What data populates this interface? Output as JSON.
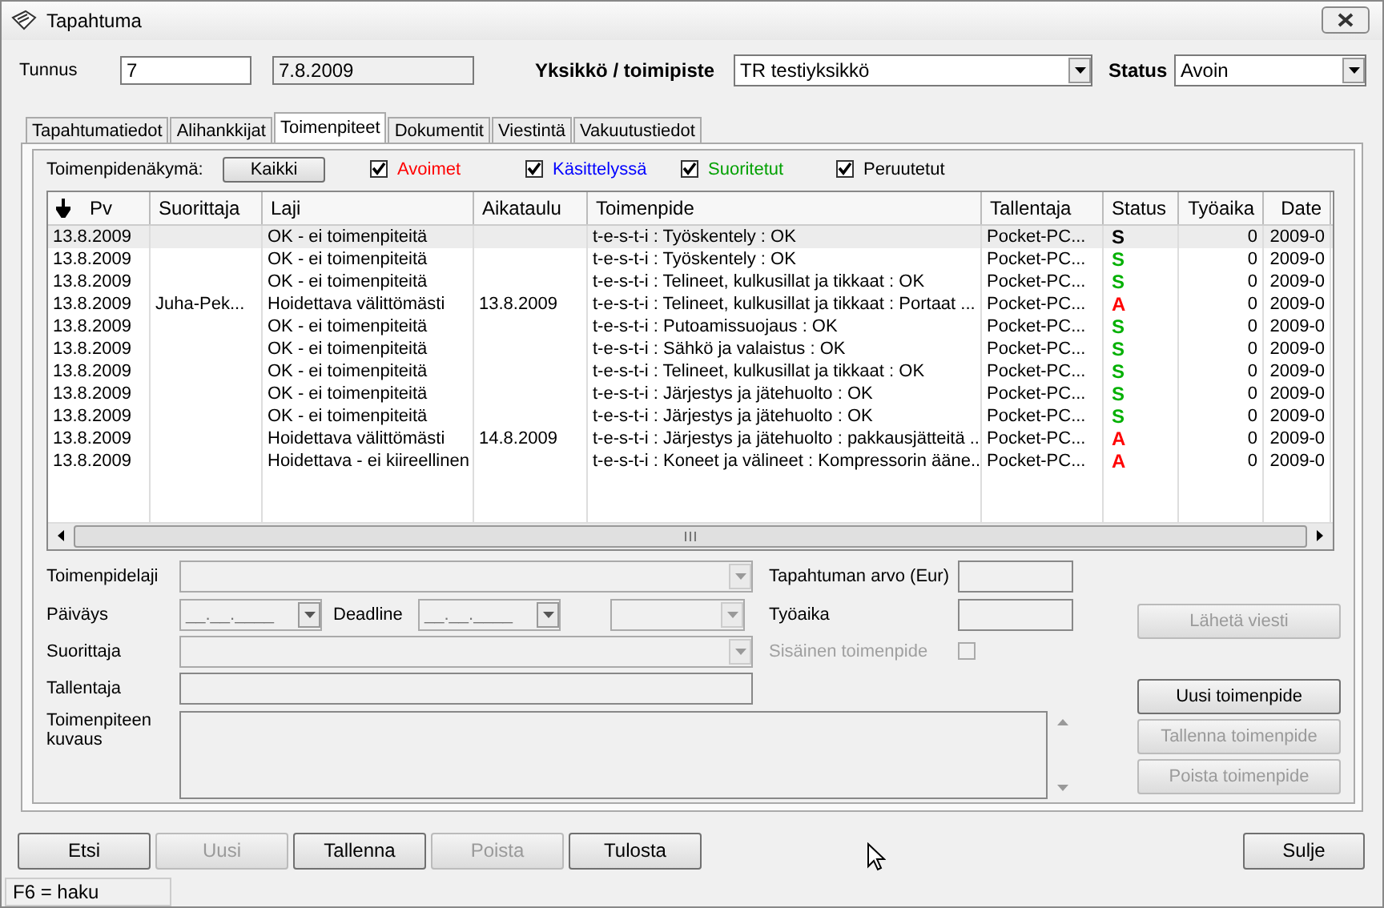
{
  "window": {
    "title": "Tapahtuma"
  },
  "header": {
    "id_label": "Tunnus",
    "id_value": "7",
    "date_value": "7.8.2009",
    "unit_label": "Yksikkö / toimipiste",
    "unit_value": "TR testiyksikkö",
    "status_label": "Status",
    "status_value": "Avoin"
  },
  "tabs": [
    {
      "label": "Tapahtumatiedot",
      "selected": false
    },
    {
      "label": "Alihankkijat",
      "selected": false
    },
    {
      "label": "Toimenpiteet",
      "selected": true
    },
    {
      "label": "Dokumentit",
      "selected": false
    },
    {
      "label": "Viestintä",
      "selected": false
    },
    {
      "label": "Vakuutustiedot",
      "selected": false
    }
  ],
  "filter": {
    "label": "Toimenpidenäkymä:",
    "button": "Kaikki",
    "options": [
      {
        "label": "Avoimet",
        "checked": true,
        "color": "#ff0000"
      },
      {
        "label": "Käsittelyssä",
        "checked": true,
        "color": "#0000ff"
      },
      {
        "label": "Suoritetut",
        "checked": true,
        "color": "#00a000"
      },
      {
        "label": "Peruutetut",
        "checked": true,
        "color": "#000000"
      }
    ]
  },
  "table": {
    "columns": [
      "Pv",
      "Suorittaja",
      "Laji",
      "Aikataulu",
      "Toimenpide",
      "Tallentaja",
      "Status",
      "Työaika",
      "Date"
    ],
    "rows": [
      {
        "pv": "13.8.2009",
        "suorittaja": "",
        "laji": "OK - ei toimenpiteitä",
        "aikataulu": "",
        "toimenpide": "t-e-s-t-i : Työskentely : OK",
        "tallentaja": "Pocket-PC...",
        "status": "S",
        "color": "#000000",
        "tyoaika": "0",
        "date": "2009-0",
        "selected": true
      },
      {
        "pv": "13.8.2009",
        "suorittaja": "",
        "laji": "OK - ei toimenpiteitä",
        "aikataulu": "",
        "toimenpide": "t-e-s-t-i : Työskentely : OK",
        "tallentaja": "Pocket-PC...",
        "status": "S",
        "color": "#00b000",
        "tyoaika": "0",
        "date": "2009-0",
        "selected": false
      },
      {
        "pv": "13.8.2009",
        "suorittaja": "",
        "laji": "OK - ei toimenpiteitä",
        "aikataulu": "",
        "toimenpide": "t-e-s-t-i : Telineet, kulkusillat ja tikkaat : OK",
        "tallentaja": "Pocket-PC...",
        "status": "S",
        "color": "#00b000",
        "tyoaika": "0",
        "date": "2009-0",
        "selected": false
      },
      {
        "pv": "13.8.2009",
        "suorittaja": "Juha-Pek...",
        "laji": "Hoidettava välittömästi",
        "aikataulu": "13.8.2009",
        "toimenpide": "t-e-s-t-i : Telineet, kulkusillat ja tikkaat : Portaat ...",
        "tallentaja": "Pocket-PC...",
        "status": "A",
        "color": "#ff0000",
        "tyoaika": "0",
        "date": "2009-0",
        "selected": false
      },
      {
        "pv": "13.8.2009",
        "suorittaja": "",
        "laji": "OK - ei toimenpiteitä",
        "aikataulu": "",
        "toimenpide": "t-e-s-t-i : Putoamissuojaus : OK",
        "tallentaja": "Pocket-PC...",
        "status": "S",
        "color": "#00b000",
        "tyoaika": "0",
        "date": "2009-0",
        "selected": false
      },
      {
        "pv": "13.8.2009",
        "suorittaja": "",
        "laji": "OK - ei toimenpiteitä",
        "aikataulu": "",
        "toimenpide": "t-e-s-t-i : Sähkö ja valaistus : OK",
        "tallentaja": "Pocket-PC...",
        "status": "S",
        "color": "#00b000",
        "tyoaika": "0",
        "date": "2009-0",
        "selected": false
      },
      {
        "pv": "13.8.2009",
        "suorittaja": "",
        "laji": "OK - ei toimenpiteitä",
        "aikataulu": "",
        "toimenpide": "t-e-s-t-i : Telineet, kulkusillat ja tikkaat : OK",
        "tallentaja": "Pocket-PC...",
        "status": "S",
        "color": "#00b000",
        "tyoaika": "0",
        "date": "2009-0",
        "selected": false
      },
      {
        "pv": "13.8.2009",
        "suorittaja": "",
        "laji": "OK - ei toimenpiteitä",
        "aikataulu": "",
        "toimenpide": "t-e-s-t-i : Järjestys ja jätehuolto : OK",
        "tallentaja": "Pocket-PC...",
        "status": "S",
        "color": "#00b000",
        "tyoaika": "0",
        "date": "2009-0",
        "selected": false
      },
      {
        "pv": "13.8.2009",
        "suorittaja": "",
        "laji": "OK - ei toimenpiteitä",
        "aikataulu": "",
        "toimenpide": "t-e-s-t-i : Järjestys ja jätehuolto : OK",
        "tallentaja": "Pocket-PC...",
        "status": "S",
        "color": "#00b000",
        "tyoaika": "0",
        "date": "2009-0",
        "selected": false
      },
      {
        "pv": "13.8.2009",
        "suorittaja": "",
        "laji": "Hoidettava välittömästi",
        "aikataulu": "14.8.2009",
        "toimenpide": "t-e-s-t-i : Järjestys ja jätehuolto : pakkausjätteitä ...",
        "tallentaja": "Pocket-PC...",
        "status": "A",
        "color": "#ff0000",
        "tyoaika": "0",
        "date": "2009-0",
        "selected": false
      },
      {
        "pv": "13.8.2009",
        "suorittaja": "",
        "laji": "Hoidettava - ei kiireellinen",
        "aikataulu": "",
        "toimenpide": "t-e-s-t-i : Koneet ja välineet : Kompressorin ääne...",
        "tallentaja": "Pocket-PC...",
        "status": "A",
        "color": "#ff0000",
        "tyoaika": "0",
        "date": "2009-0",
        "selected": false
      }
    ]
  },
  "form": {
    "type_label": "Toimenpidelaji",
    "date_label": "Päiväys",
    "date_value": "__.__.____",
    "deadline_label": "Deadline",
    "deadline_value": "__.__.____",
    "performer_label": "Suorittaja",
    "recorder_label": "Tallentaja",
    "description_label": "Toimenpiteen kuvaus",
    "value_label": "Tapahtuman arvo (Eur)",
    "worktime_label": "Työaika",
    "internal": {
      "label": "Sisäinen toimenpide",
      "checked": false,
      "disabled": true
    }
  },
  "side_buttons": [
    {
      "label": "Lähetä viesti",
      "disabled": true
    },
    {
      "label": "Uusi toimenpide",
      "disabled": false
    },
    {
      "label": "Tallenna toimenpide",
      "disabled": true
    },
    {
      "label": "Poista toimenpide",
      "disabled": true
    }
  ],
  "buttons": [
    {
      "label": "Etsi",
      "disabled": false
    },
    {
      "label": "Uusi",
      "disabled": true
    },
    {
      "label": "Tallenna",
      "disabled": false
    },
    {
      "label": "Poista",
      "disabled": true
    },
    {
      "label": "Tulosta",
      "disabled": false
    }
  ],
  "close_button": "Sulje",
  "status_bar": "F6 = haku"
}
